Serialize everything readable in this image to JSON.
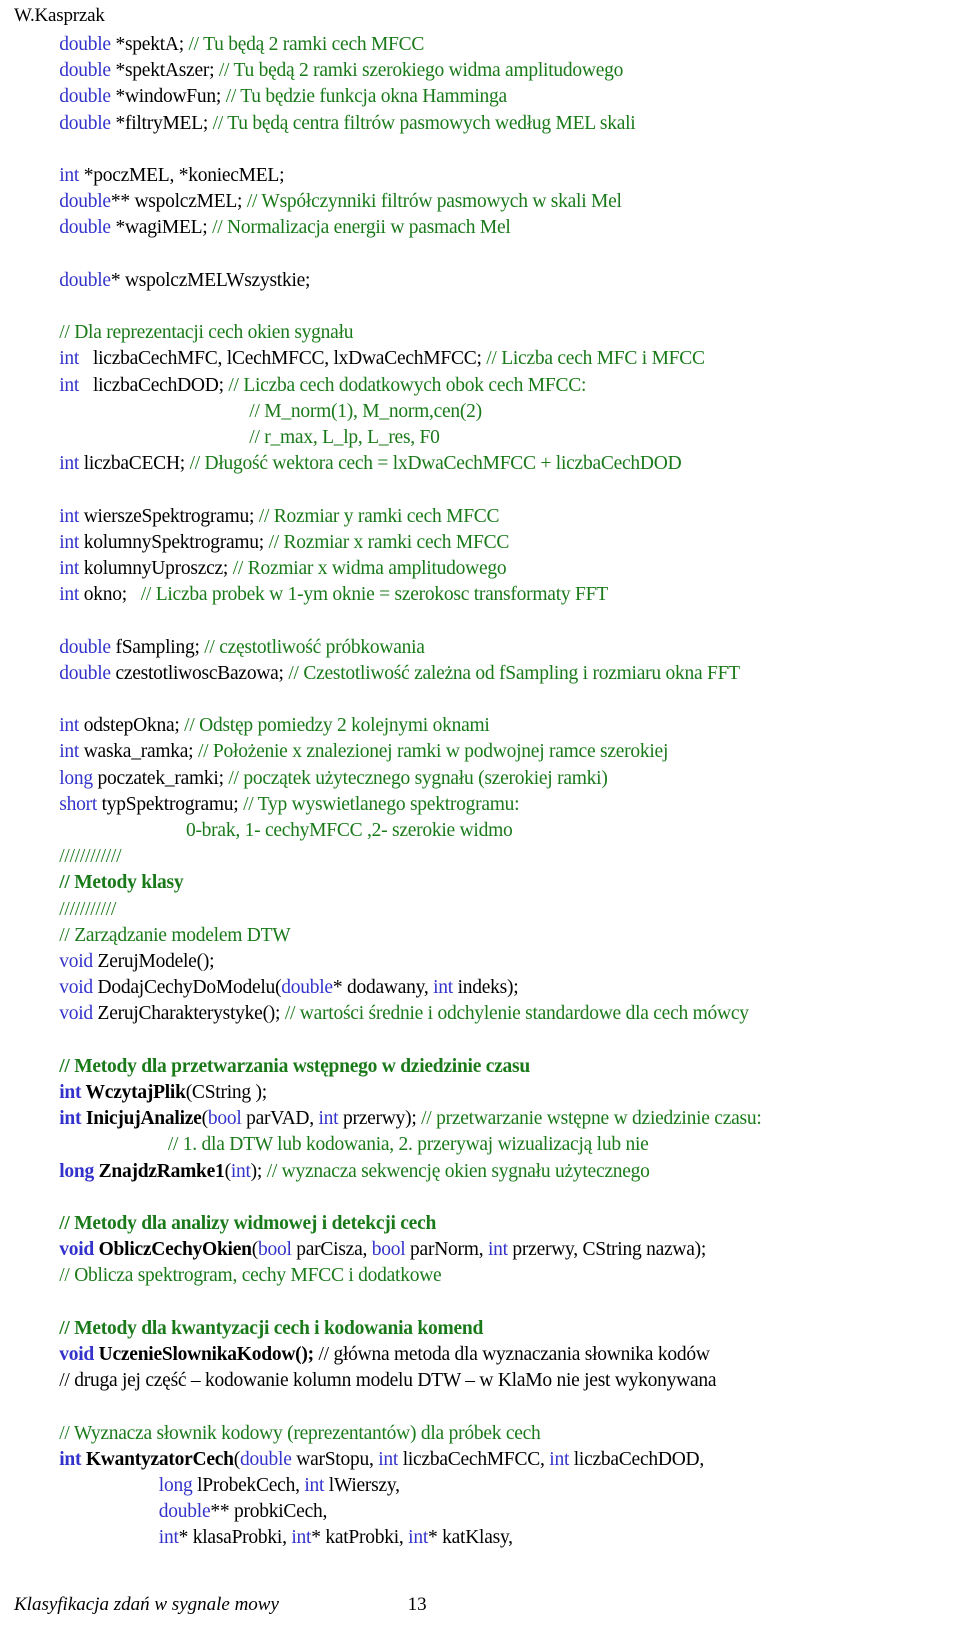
{
  "header": {
    "running_head": "W.Kasprzak"
  },
  "footer": {
    "title": "Klasyfikacja zdań w sygnale mowy",
    "page_number": "13"
  },
  "colors": {
    "keyword": "#3333cc",
    "comment": "#1a7a1a",
    "identifier": "#000000",
    "background": "#ffffff"
  },
  "code": {
    "lines": [
      {
        "indent": 5,
        "tokens": [
          {
            "t": "double",
            "c": "kw"
          },
          {
            "t": " *spektA; ",
            "c": "id"
          },
          {
            "t": "// Tu będą 2 ramki cech MFCC",
            "c": "cm"
          }
        ]
      },
      {
        "indent": 5,
        "tokens": [
          {
            "t": "double",
            "c": "kw"
          },
          {
            "t": " *spektAszer; ",
            "c": "id"
          },
          {
            "t": "// Tu będą 2 ramki szerokiego widma amplitudowego",
            "c": "cm"
          }
        ]
      },
      {
        "indent": 5,
        "tokens": [
          {
            "t": "double",
            "c": "kw"
          },
          {
            "t": " *windowFun; ",
            "c": "id"
          },
          {
            "t": "// Tu będzie funkcja okna Hamminga",
            "c": "cm"
          }
        ]
      },
      {
        "indent": 5,
        "tokens": [
          {
            "t": "double",
            "c": "kw"
          },
          {
            "t": " *filtryMEL; ",
            "c": "id"
          },
          {
            "t": "// Tu będą centra filtrów pasmowych według MEL skali",
            "c": "cm"
          }
        ]
      },
      {
        "indent": 0,
        "blank": true,
        "tokens": []
      },
      {
        "indent": 5,
        "tokens": [
          {
            "t": "int",
            "c": "kw"
          },
          {
            "t": " *poczMEL, *koniecMEL;",
            "c": "id"
          }
        ]
      },
      {
        "indent": 5,
        "tokens": [
          {
            "t": "double",
            "c": "kw"
          },
          {
            "t": "** wspolczMEL; ",
            "c": "id"
          },
          {
            "t": "// Współczynniki filtrów pasmowych w skali Mel",
            "c": "cm"
          }
        ]
      },
      {
        "indent": 5,
        "tokens": [
          {
            "t": "double",
            "c": "kw"
          },
          {
            "t": " *wagiMEL; ",
            "c": "id"
          },
          {
            "t": "// Normalizacja energii w pasmach Mel",
            "c": "cm"
          }
        ]
      },
      {
        "indent": 0,
        "blank": true,
        "tokens": []
      },
      {
        "indent": 5,
        "tokens": [
          {
            "t": "double",
            "c": "kw"
          },
          {
            "t": "* wspolczMELWszystkie;",
            "c": "id"
          }
        ]
      },
      {
        "indent": 0,
        "blank": true,
        "tokens": []
      },
      {
        "indent": 5,
        "tokens": [
          {
            "t": "// Dla reprezentacji cech okien sygnału",
            "c": "cm"
          }
        ]
      },
      {
        "indent": 5,
        "tokens": [
          {
            "t": "int",
            "c": "kw"
          },
          {
            "t": "   liczbaCechMFC, lCechMFCC, lxDwaCechMFCC; ",
            "c": "id"
          },
          {
            "t": "// Liczba cech MFC i MFCC",
            "c": "cm"
          }
        ]
      },
      {
        "indent": 5,
        "tokens": [
          {
            "t": "int",
            "c": "kw"
          },
          {
            "t": "   liczbaCechDOD; ",
            "c": "id"
          },
          {
            "t": "// Liczba cech dodatkowych obok cech MFCC:",
            "c": "cm"
          }
        ]
      },
      {
        "indent": 26,
        "tokens": [
          {
            "t": "// M_norm(1), M_norm,cen(2)",
            "c": "cm"
          }
        ]
      },
      {
        "indent": 26,
        "tokens": [
          {
            "t": "// r_max, L_lp, L_res, F0",
            "c": "cm"
          }
        ]
      },
      {
        "indent": 5,
        "tokens": [
          {
            "t": "int",
            "c": "kw"
          },
          {
            "t": " liczbaCECH; ",
            "c": "id"
          },
          {
            "t": "// Długość wektora cech = lxDwaCechMFCC + liczbaCechDOD",
            "c": "cm"
          }
        ]
      },
      {
        "indent": 0,
        "blank": true,
        "tokens": []
      },
      {
        "indent": 5,
        "tokens": [
          {
            "t": "int",
            "c": "kw"
          },
          {
            "t": " wierszeSpektrogramu; ",
            "c": "id"
          },
          {
            "t": "// Rozmiar y ramki cech MFCC",
            "c": "cm"
          }
        ]
      },
      {
        "indent": 5,
        "tokens": [
          {
            "t": "int",
            "c": "kw"
          },
          {
            "t": " kolumnySpektrogramu; ",
            "c": "id"
          },
          {
            "t": "// Rozmiar x ramki cech MFCC",
            "c": "cm"
          }
        ]
      },
      {
        "indent": 5,
        "tokens": [
          {
            "t": "int",
            "c": "kw"
          },
          {
            "t": " kolumnyUproszcz; ",
            "c": "id"
          },
          {
            "t": "// Rozmiar x widma amplitudowego",
            "c": "cm"
          }
        ]
      },
      {
        "indent": 5,
        "tokens": [
          {
            "t": "int",
            "c": "kw"
          },
          {
            "t": " okno;   ",
            "c": "id"
          },
          {
            "t": "// Liczba probek w 1-ym oknie = szerokosc transformaty FFT",
            "c": "cm"
          }
        ]
      },
      {
        "indent": 0,
        "blank": true,
        "tokens": []
      },
      {
        "indent": 5,
        "tokens": [
          {
            "t": "double",
            "c": "kw"
          },
          {
            "t": " fSampling; ",
            "c": "id"
          },
          {
            "t": "// częstotliwość próbkowania",
            "c": "cm"
          }
        ]
      },
      {
        "indent": 5,
        "tokens": [
          {
            "t": "double",
            "c": "kw"
          },
          {
            "t": " czestotliwoscBazowa; ",
            "c": "id"
          },
          {
            "t": "// Czestotliwość zależna od fSampling i rozmiaru okna FFT",
            "c": "cm"
          }
        ]
      },
      {
        "indent": 0,
        "blank": true,
        "tokens": []
      },
      {
        "indent": 5,
        "tokens": [
          {
            "t": "int",
            "c": "kw"
          },
          {
            "t": " odstepOkna; ",
            "c": "id"
          },
          {
            "t": "// Odstęp pomiedzy 2 kolejnymi oknami",
            "c": "cm"
          }
        ]
      },
      {
        "indent": 5,
        "tokens": [
          {
            "t": "int",
            "c": "kw"
          },
          {
            "t": " waska_ramka; ",
            "c": "id"
          },
          {
            "t": "// Położenie x znalezionej ramki w podwojnej ramce szerokiej",
            "c": "cm"
          }
        ]
      },
      {
        "indent": 5,
        "tokens": [
          {
            "t": "long",
            "c": "kw"
          },
          {
            "t": " poczatek_ramki; ",
            "c": "id"
          },
          {
            "t": "// początek użytecznego sygnału (szerokiej ramki)",
            "c": "cm"
          }
        ]
      },
      {
        "indent": 5,
        "tokens": [
          {
            "t": "short",
            "c": "kw"
          },
          {
            "t": " typSpektrogramu; ",
            "c": "id"
          },
          {
            "t": "// Typ wyswietlanego spektrogramu:",
            "c": "cm"
          }
        ]
      },
      {
        "indent": 19,
        "tokens": [
          {
            "t": "0-brak, 1- cechyMFCC ,2- szerokie widmo",
            "c": "cm"
          }
        ]
      },
      {
        "indent": 5,
        "tokens": [
          {
            "t": "////////////",
            "c": "cm"
          }
        ]
      },
      {
        "indent": 5,
        "bold": true,
        "tokens": [
          {
            "t": "// Metody klasy",
            "c": "cm b"
          }
        ]
      },
      {
        "indent": 5,
        "tokens": [
          {
            "t": "///////////",
            "c": "cm"
          }
        ]
      },
      {
        "indent": 5,
        "tokens": [
          {
            "t": "// Zarządzanie modelem DTW",
            "c": "cm"
          }
        ]
      },
      {
        "indent": 5,
        "tokens": [
          {
            "t": "void",
            "c": "kw"
          },
          {
            "t": " ZerujModele();",
            "c": "id"
          }
        ]
      },
      {
        "indent": 5,
        "tokens": [
          {
            "t": "void",
            "c": "kw"
          },
          {
            "t": " DodajCechyDoModelu(",
            "c": "id"
          },
          {
            "t": "double",
            "c": "kw"
          },
          {
            "t": "* dodawany, ",
            "c": "id"
          },
          {
            "t": "int",
            "c": "kw"
          },
          {
            "t": " indeks);",
            "c": "id"
          }
        ]
      },
      {
        "indent": 5,
        "tokens": [
          {
            "t": "void",
            "c": "kw"
          },
          {
            "t": " ZerujCharakterystyke(); ",
            "c": "id"
          },
          {
            "t": "// wartości średnie i odchylenie standardowe dla cech mówcy",
            "c": "cm"
          }
        ]
      },
      {
        "indent": 0,
        "blank": true,
        "tokens": []
      },
      {
        "indent": 5,
        "tokens": [
          {
            "t": "// Metody dla przetwarzania wstępnego w dziedzinie czasu",
            "c": "cm b"
          }
        ]
      },
      {
        "indent": 5,
        "tokens": [
          {
            "t": "int",
            "c": "kw b"
          },
          {
            "t": " WczytajPlik",
            "c": "id b"
          },
          {
            "t": "(CString );",
            "c": "id"
          }
        ]
      },
      {
        "indent": 5,
        "tokens": [
          {
            "t": "int",
            "c": "kw b"
          },
          {
            "t": " InicjujAnalize",
            "c": "id b"
          },
          {
            "t": "(",
            "c": "id"
          },
          {
            "t": "bool",
            "c": "kw"
          },
          {
            "t": " parVAD, ",
            "c": "id"
          },
          {
            "t": "int",
            "c": "kw"
          },
          {
            "t": " przerwy); ",
            "c": "id"
          },
          {
            "t": "// przetwarzanie wstępne w dziedzinie czasu:",
            "c": "cm"
          }
        ]
      },
      {
        "indent": 17,
        "tokens": [
          {
            "t": "// 1. dla DTW lub kodowania, 2. przerywaj wizualizacją lub nie",
            "c": "cm"
          }
        ]
      },
      {
        "indent": 5,
        "tokens": [
          {
            "t": "long",
            "c": "kw b"
          },
          {
            "t": " ZnajdzRamke1",
            "c": "id b"
          },
          {
            "t": "(",
            "c": "id"
          },
          {
            "t": "int",
            "c": "kw"
          },
          {
            "t": "); ",
            "c": "id"
          },
          {
            "t": "// wyznacza sekwencję okien sygnału użytecznego",
            "c": "cm"
          }
        ]
      },
      {
        "indent": 0,
        "blank": true,
        "tokens": []
      },
      {
        "indent": 5,
        "tokens": [
          {
            "t": "// Metody dla analizy widmowej i detekcji cech",
            "c": "cm b"
          }
        ]
      },
      {
        "indent": 5,
        "tokens": [
          {
            "t": "void",
            "c": "kw b"
          },
          {
            "t": " ObliczCechyOkien",
            "c": "id b"
          },
          {
            "t": "(",
            "c": "id"
          },
          {
            "t": "bool",
            "c": "kw"
          },
          {
            "t": " parCisza, ",
            "c": "id"
          },
          {
            "t": "bool",
            "c": "kw"
          },
          {
            "t": " parNorm, ",
            "c": "id"
          },
          {
            "t": "int",
            "c": "kw"
          },
          {
            "t": " przerwy, CString nazwa);",
            "c": "id"
          }
        ]
      },
      {
        "indent": 5,
        "tokens": [
          {
            "t": "// Oblicza spektrogram, cechy MFCC i dodatkowe",
            "c": "cm"
          }
        ]
      },
      {
        "indent": 0,
        "blank": true,
        "tokens": []
      },
      {
        "indent": 5,
        "tokens": [
          {
            "t": "// Metody dla kwantyzacji cech i kodowania komend",
            "c": "cm b"
          }
        ]
      },
      {
        "indent": 5,
        "tokens": [
          {
            "t": "void",
            "c": "kw b"
          },
          {
            "t": " UczenieSlownikaKodow();",
            "c": "id b"
          },
          {
            "t": " // główna metoda dla wyznaczania słownika kodów",
            "c": "id"
          }
        ]
      },
      {
        "indent": 5,
        "tokens": [
          {
            "t": "// druga jej część – kodowanie kolumn modelu DTW – w KlaMo nie jest wykonywana",
            "c": "id"
          }
        ]
      },
      {
        "indent": 0,
        "blank": true,
        "tokens": []
      },
      {
        "indent": 5,
        "tokens": [
          {
            "t": "// Wyznacza słownik kodowy (reprezentantów) dla próbek cech",
            "c": "cm"
          }
        ]
      },
      {
        "indent": 5,
        "tokens": [
          {
            "t": "int",
            "c": "kw b"
          },
          {
            "t": " KwantyzatorCech",
            "c": "id b"
          },
          {
            "t": "(",
            "c": "id"
          },
          {
            "t": "double",
            "c": "kw"
          },
          {
            "t": " warStopu, ",
            "c": "id"
          },
          {
            "t": "int",
            "c": "kw"
          },
          {
            "t": " liczbaCechMFCC, ",
            "c": "id"
          },
          {
            "t": "int",
            "c": "kw"
          },
          {
            "t": " liczbaCechDOD,",
            "c": "id"
          }
        ]
      },
      {
        "indent": 16,
        "tokens": [
          {
            "t": "long",
            "c": "kw"
          },
          {
            "t": " lProbekCech, ",
            "c": "id"
          },
          {
            "t": "int",
            "c": "kw"
          },
          {
            "t": " lWierszy,",
            "c": "id"
          }
        ]
      },
      {
        "indent": 16,
        "tokens": [
          {
            "t": "double",
            "c": "kw"
          },
          {
            "t": "** probkiCech,",
            "c": "id"
          }
        ]
      },
      {
        "indent": 16,
        "tokens": [
          {
            "t": "int",
            "c": "kw"
          },
          {
            "t": "* klasaProbki, ",
            "c": "id"
          },
          {
            "t": "int",
            "c": "kw"
          },
          {
            "t": "* katProbki, ",
            "c": "id"
          },
          {
            "t": "int",
            "c": "kw"
          },
          {
            "t": "* katKlasy,",
            "c": "id"
          }
        ]
      }
    ]
  }
}
